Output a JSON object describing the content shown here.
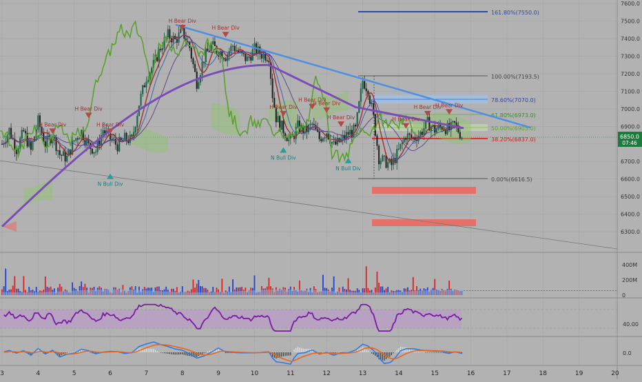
{
  "colors": {
    "background": "#b2b2b2",
    "grid": "#a6a6a6",
    "candle_up": "#15503a",
    "candle_down": "#2a2a2a",
    "trend_line": "#4d8fe0",
    "ma_purple": "#7b4cb8",
    "ichimoku_green": "#5aa02c",
    "ma_red": "#9c2f2f",
    "ma_blue": "#3a55b8",
    "fib_blue": "#2a4aa8",
    "fib_red": "#e03030",
    "zone_red": "#e5706a",
    "rsi_line": "#7a1aa0",
    "rsi_band": "#b89ec6",
    "macd_blue": "#2c7be5",
    "macd_orange": "#e8661c",
    "vol_up": "#2244cc",
    "vol_down": "#dd2222",
    "price_tag": "#1b7a3c",
    "bear_marker": "#b04a4a",
    "bull_marker": "#2e9a9a"
  },
  "chart_data": [
    {
      "type": "candlestick",
      "title": "",
      "x_tick_labels": [
        "3",
        "4",
        "5",
        "6",
        "7",
        "8",
        "9",
        "10",
        "11",
        "12",
        "13",
        "14",
        "15",
        "16",
        "17",
        "18",
        "19",
        "20"
      ],
      "y_tick_labels": [
        "6300.0",
        "6400.0",
        "6500.0",
        "6600.0",
        "6700.0",
        "6800.0",
        "6900.0",
        "7000.0",
        "7100.0",
        "7200.0",
        "7300.0",
        "7400.0",
        "7500.0",
        "7600.0"
      ],
      "ylim": [
        6230,
        7630
      ],
      "close_path": [
        [
          3.0,
          6800
        ],
        [
          3.2,
          6880
        ],
        [
          3.4,
          6770
        ],
        [
          3.6,
          6870
        ],
        [
          3.8,
          6760
        ],
        [
          4.0,
          6930
        ],
        [
          4.2,
          6800
        ],
        [
          4.4,
          6850
        ],
        [
          4.6,
          6740
        ],
        [
          4.8,
          6720
        ],
        [
          5.0,
          6820
        ],
        [
          5.2,
          6870
        ],
        [
          5.4,
          6790
        ],
        [
          5.6,
          6760
        ],
        [
          5.8,
          6880
        ],
        [
          6.0,
          6830
        ],
        [
          6.2,
          6790
        ],
        [
          6.4,
          6830
        ],
        [
          6.6,
          6820
        ],
        [
          6.8,
          7030
        ],
        [
          7.0,
          7180
        ],
        [
          7.2,
          7250
        ],
        [
          7.4,
          7350
        ],
        [
          7.6,
          7420
        ],
        [
          7.8,
          7390
        ],
        [
          8.0,
          7440
        ],
        [
          8.2,
          7350
        ],
        [
          8.4,
          7150
        ],
        [
          8.6,
          7290
        ],
        [
          8.8,
          7360
        ],
        [
          9.0,
          7330
        ],
        [
          9.2,
          7300
        ],
        [
          9.4,
          7360
        ],
        [
          9.6,
          7310
        ],
        [
          9.8,
          7280
        ],
        [
          10.0,
          7340
        ],
        [
          10.2,
          7310
        ],
        [
          10.4,
          7300
        ],
        [
          10.5,
          7080
        ],
        [
          10.6,
          6950
        ],
        [
          10.8,
          6880
        ],
        [
          11.0,
          6810
        ],
        [
          11.2,
          6900
        ],
        [
          11.4,
          6870
        ],
        [
          11.6,
          6910
        ],
        [
          11.8,
          6830
        ],
        [
          12.0,
          6870
        ],
        [
          12.2,
          6790
        ],
        [
          12.4,
          6820
        ],
        [
          12.6,
          6860
        ],
        [
          12.8,
          6880
        ],
        [
          13.0,
          7160
        ],
        [
          13.15,
          7110
        ],
        [
          13.3,
          6950
        ],
        [
          13.45,
          6720
        ],
        [
          13.6,
          6700
        ],
        [
          13.8,
          6680
        ],
        [
          14.0,
          6760
        ],
        [
          14.2,
          6850
        ],
        [
          14.4,
          6830
        ],
        [
          14.6,
          6860
        ],
        [
          14.8,
          6920
        ],
        [
          15.0,
          6880
        ],
        [
          15.2,
          6900
        ],
        [
          15.4,
          6880
        ],
        [
          15.55,
          6910
        ],
        [
          15.75,
          6845
        ]
      ],
      "volume_tick_labels": [
        "0",
        "200M",
        "400M"
      ],
      "rsi_tick_labels": [
        "40.00"
      ],
      "macd_tick_labels": [
        "0.0"
      ]
    }
  ],
  "labels": {
    "fib_1618": "161.80%(7550.0)",
    "fib_100": "100.00%(7193.5)",
    "fib_786": "78.60%(7070.0)",
    "fib_618": "61.80%(6973.0)",
    "fib_50": "50.00%(6905.0)",
    "fib_382": "38.20%(6837.0)",
    "fib_0": "0.00%(6616.5)",
    "price_now": "6850.0",
    "countdown": "07:46",
    "annotations": [
      {
        "id": "ann-hbear-1",
        "text": "H Bear Div"
      },
      {
        "id": "ann-hbear-2",
        "text": "H Bear Div"
      },
      {
        "id": "ann-hbear-3",
        "text": "H Bear Div"
      },
      {
        "id": "ann-hbear-4",
        "text": "H Bear Div"
      },
      {
        "id": "ann-hbear-5",
        "text": "H Bear Div"
      },
      {
        "id": "ann-hbear-6",
        "text": "H Bear Div"
      },
      {
        "id": "ann-hbear-7",
        "text": "H Bear Div"
      },
      {
        "id": "ann-hbear-8",
        "text": "H Bear Div"
      },
      {
        "id": "ann-hbear-9",
        "text": "H Bear Div"
      },
      {
        "id": "ann-hbear-10",
        "text": "H Bear Div"
      },
      {
        "id": "ann-hbear-11",
        "text": "H Bear Div"
      },
      {
        "id": "ann-hbear-12",
        "text": "H Bear Div"
      },
      {
        "id": "ann-nbull-1",
        "text": "N Bull Div"
      },
      {
        "id": "ann-nbull-2",
        "text": "N Bull Div"
      },
      {
        "id": "ann-nbull-3",
        "text": "N Bull Div"
      }
    ]
  }
}
